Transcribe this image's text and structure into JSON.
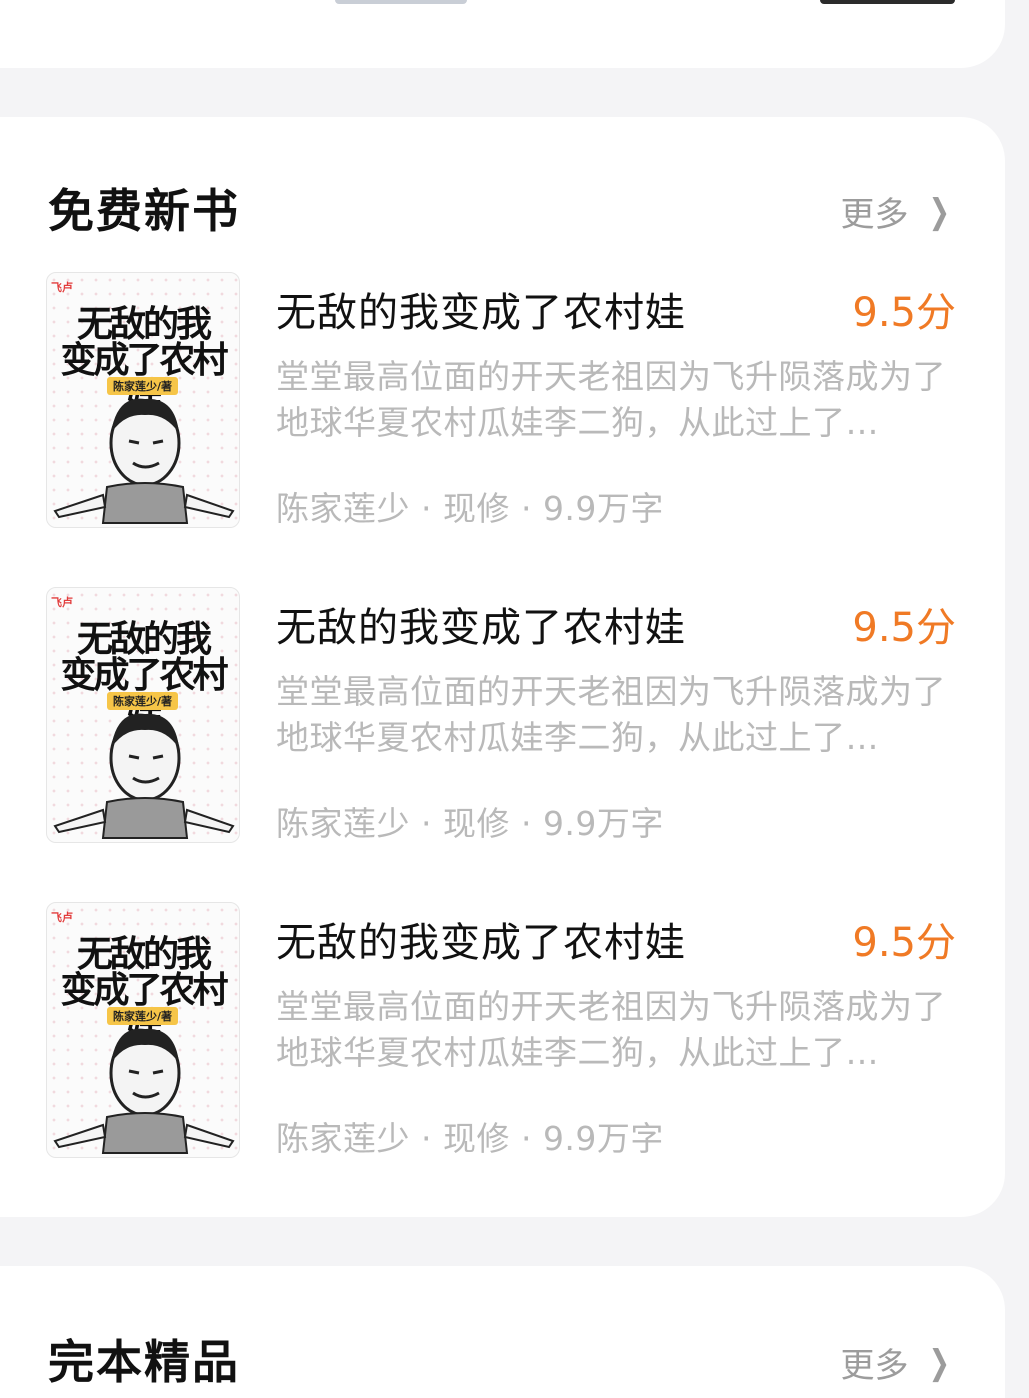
{
  "sections": [
    {
      "title": "免费新书",
      "more_label": "更多",
      "books": [
        {
          "title": "无敌的我变成了农村娃",
          "score": "9.5分",
          "desc": "堂堂最高位面的开天老祖因为飞升陨落成为了地球华夏农村瓜娃李二狗，从此过上了…",
          "meta": "陈家莲少 · 现修 · 9.9万字",
          "cover": {
            "line1": "无敌的我",
            "line2": "变成了农村娃",
            "author_tag": "陈家莲少/著",
            "brand": "飞卢"
          }
        },
        {
          "title": "无敌的我变成了农村娃",
          "score": "9.5分",
          "desc": "堂堂最高位面的开天老祖因为飞升陨落成为了地球华夏农村瓜娃李二狗，从此过上了…",
          "meta": "陈家莲少 · 现修 · 9.9万字",
          "cover": {
            "line1": "无敌的我",
            "line2": "变成了农村娃",
            "author_tag": "陈家莲少/著",
            "brand": "飞卢"
          }
        },
        {
          "title": "无敌的我变成了农村娃",
          "score": "9.5分",
          "desc": "堂堂最高位面的开天老祖因为飞升陨落成为了地球华夏农村瓜娃李二狗，从此过上了…",
          "meta": "陈家莲少 · 现修 · 9.9万字",
          "cover": {
            "line1": "无敌的我",
            "line2": "变成了农村娃",
            "author_tag": "陈家莲少/著",
            "brand": "飞卢"
          }
        }
      ]
    },
    {
      "title": "完本精品",
      "more_label": "更多"
    }
  ],
  "colors": {
    "score": "#f07a25",
    "muted_text": "#b9b9b9",
    "background": "#f4f4f6",
    "card": "#ffffff"
  },
  "icons": {
    "more_chevron": "chevron-right-icon"
  }
}
